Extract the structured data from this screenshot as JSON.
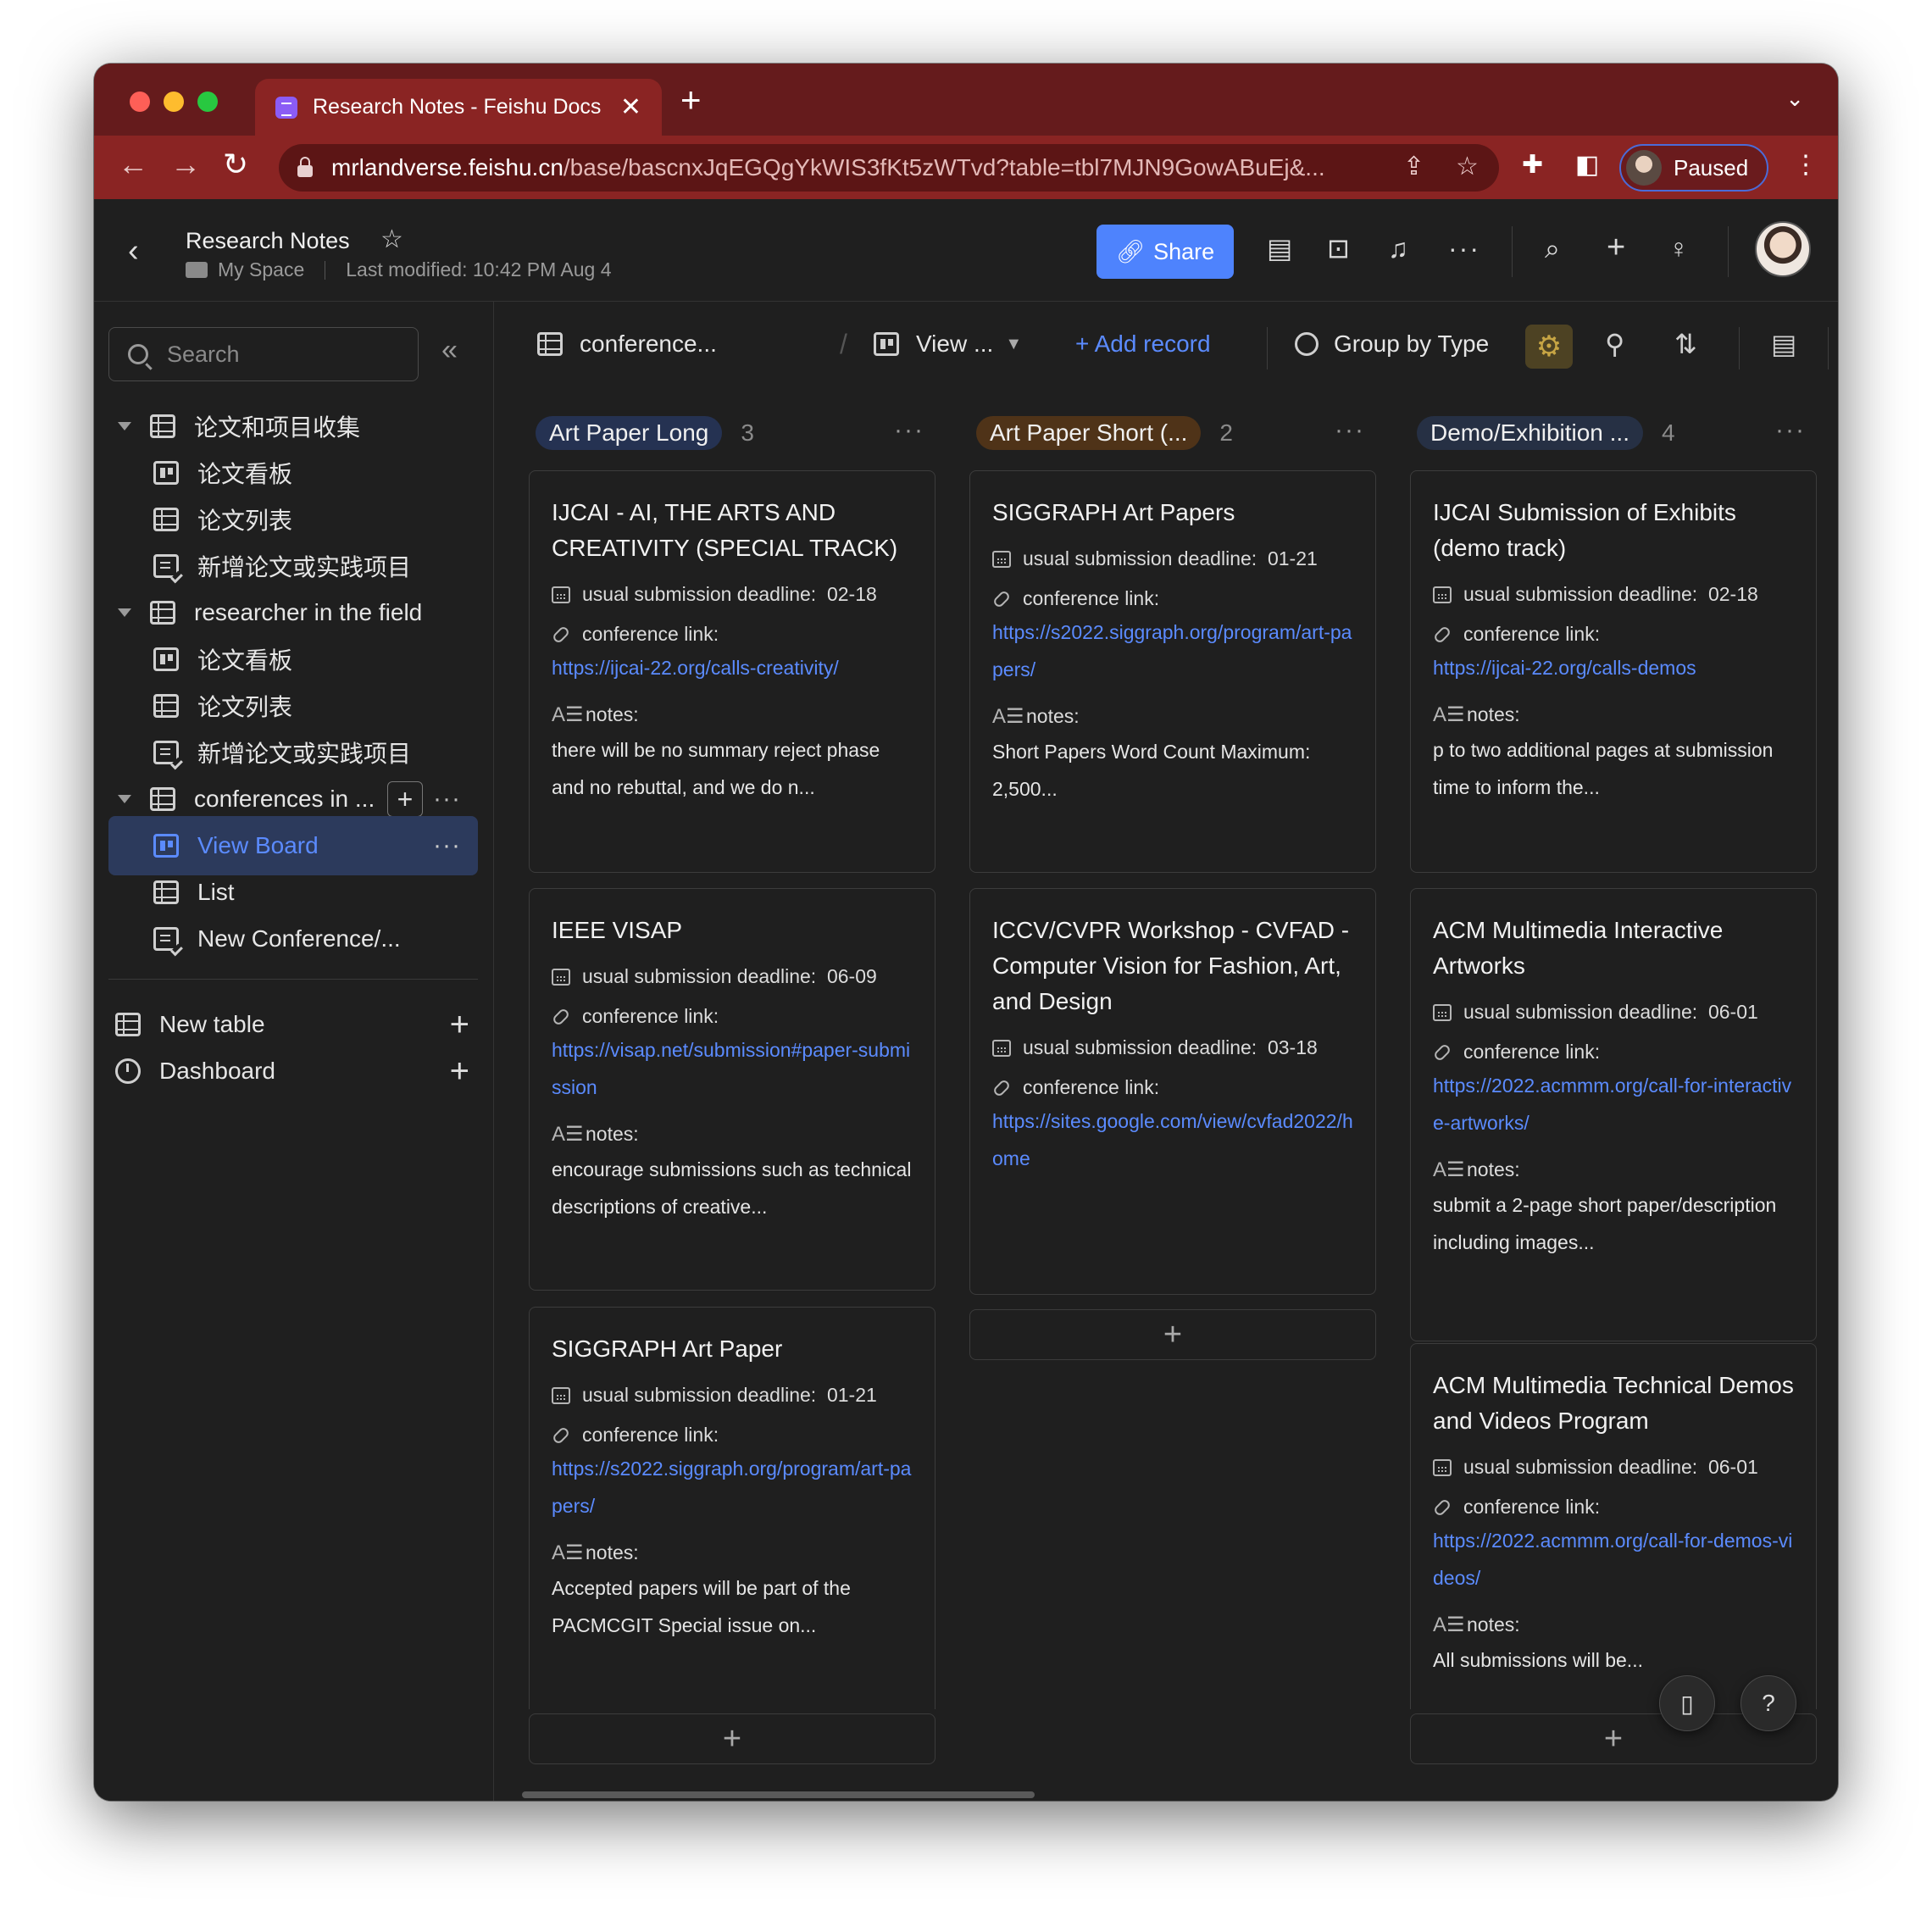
{
  "browser": {
    "tab_title": "Research Notes - Feishu Docs",
    "url_host": "mrlandverse.feishu.cn",
    "url_path": "/base/bascnxJqEGQgYkWIS3fKt5zWTvd?table=tbl7MJN9GowABuEj&...",
    "profile_label": "Paused"
  },
  "header": {
    "title": "Research Notes",
    "location": "My Space",
    "last_modified": "Last modified: 10:42 PM Aug 4",
    "share_label": "Share"
  },
  "sidebar": {
    "search_placeholder": "Search",
    "groups": [
      {
        "label": "论文和项目收集",
        "children": [
          "论文看板",
          "论文列表",
          "新增论文或实践项目"
        ]
      },
      {
        "label": "researcher in the field",
        "children": [
          "论文看板",
          "论文列表",
          "新增论文或实践项目"
        ]
      },
      {
        "label": "conferences in ...",
        "children": [
          "View Board",
          "List",
          "New Conference/..."
        ]
      }
    ],
    "new_table": "New table",
    "dashboard": "Dashboard"
  },
  "viewbar": {
    "table_name": "conference...",
    "view_name": "View ...",
    "add_record": "+ Add record",
    "group_by": "Group by Type"
  },
  "field_labels": {
    "deadline": "usual submission deadline:",
    "link": "conference link:",
    "notes": "notes:"
  },
  "columns": [
    {
      "name": "Art Paper Long",
      "count": "3",
      "color": "#253252",
      "cards": [
        {
          "title": "IJCAI - AI, THE ARTS AND CREATIVITY (SPECIAL TRACK)",
          "deadline": "02-18",
          "link": "https://ijcai-22.org/calls-creativity/",
          "notes": "there will be no summary reject phase and no rebuttal, and we do n..."
        },
        {
          "title": "IEEE VISAP",
          "deadline": "06-09",
          "link": "https://visap.net/submission#paper-submission",
          "notes": "encourage submissions such as technical descriptions of creative..."
        },
        {
          "title": "SIGGRAPH Art Paper",
          "deadline": "01-21",
          "link": "https://s2022.siggraph.org/program/art-papers/",
          "notes": "Accepted papers will be part of the PACMCGIT Special issue on..."
        }
      ]
    },
    {
      "name": "Art Paper Short (...",
      "count": "2",
      "color": "#4f3318",
      "cards": [
        {
          "title": "SIGGRAPH Art Papers",
          "deadline": "01-21",
          "link": "https://s2022.siggraph.org/program/art-papers/",
          "notes": "Short Papers Word Count Maximum: 2,500..."
        },
        {
          "title": "ICCV/CVPR Workshop - CVFAD - Computer Vision for Fashion, Art, and Design",
          "deadline": "03-18",
          "link": "https://sites.google.com/view/cvfad2022/home",
          "notes": ""
        }
      ]
    },
    {
      "name": "Demo/Exhibition ...",
      "count": "4",
      "color": "#263044",
      "cards": [
        {
          "title": "IJCAI Submission of Exhibits (demo track)",
          "deadline": "02-18",
          "link": "https://ijcai-22.org/calls-demos",
          "notes": "p to two additional pages at submission time to inform the..."
        },
        {
          "title": "ACM Multimedia Interactive Artworks",
          "deadline": "06-01",
          "link": "https://2022.acmmm.org/call-for-interactive-artworks/",
          "notes": "submit a 2-page short paper/description including images..."
        },
        {
          "title": "ACM Multimedia Technical Demos and Videos Program",
          "deadline": "06-01",
          "link": "https://2022.acmmm.org/call-for-demos-videos/",
          "notes": "All submissions will be..."
        }
      ]
    }
  ]
}
